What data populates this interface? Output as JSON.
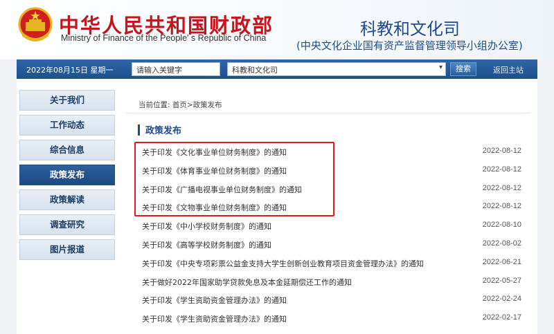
{
  "header": {
    "cn_title": "中华人民共和国财政部",
    "en_title": "Ministry of Finance of the People' s Republic of China",
    "dept_title": "科教和文化司",
    "dept_subtitle": "(中央文化企业国有资产监督管理领导小组办公室)"
  },
  "navbar": {
    "date": "2022年08月15日  星期一",
    "search_placeholder": "请输入关键字",
    "select_value": "科教和文化司",
    "search_button": "搜索",
    "home_link": "返回主站"
  },
  "sidebar": {
    "items": [
      {
        "label": "关于我们"
      },
      {
        "label": "工作动态"
      },
      {
        "label": "综合信息"
      },
      {
        "label": "政策发布"
      },
      {
        "label": "政策解读"
      },
      {
        "label": "调查研究"
      },
      {
        "label": "图片报道"
      }
    ],
    "active_index": 3
  },
  "breadcrumb": "当前位置: 首页>政策发布",
  "section_title": "政策发布",
  "articles": [
    {
      "title": "关于印发《文化事业单位财务制度》的通知",
      "date": "2022-08-12"
    },
    {
      "title": "关于印发《体育事业单位财务制度》的通知",
      "date": "2022-08-12"
    },
    {
      "title": "关于印发《广播电视事业单位财务制度》的通知",
      "date": "2022-08-12"
    },
    {
      "title": "关于印发《文物事业单位财务制度》的通知",
      "date": "2022-08-12"
    },
    {
      "title": "关于印发《中小学校财务制度》的通知",
      "date": "2022-08-10"
    },
    {
      "title": "关于印发《高等学校财务制度》的通知",
      "date": "2022-08-02"
    },
    {
      "title": "关于印发《中央专项彩票公益金支持大学生创新创业教育项目资金管理办法》的通知",
      "date": "2022-06-21"
    },
    {
      "title": "关于做好2022年国家助学贷款免息及本金延期偿还工作的通知",
      "date": "2022-05-27"
    },
    {
      "title": "关于印发《学生资助资金管理办法》的通知",
      "date": "2022-02-24"
    },
    {
      "title": "关于印发《学生资助资金管理办法》的通知",
      "date": "2022-02-17"
    }
  ],
  "colors": {
    "brand_red": "#c3161c",
    "brand_blue": "#1f4b8a",
    "highlight": "#e21c1c"
  }
}
